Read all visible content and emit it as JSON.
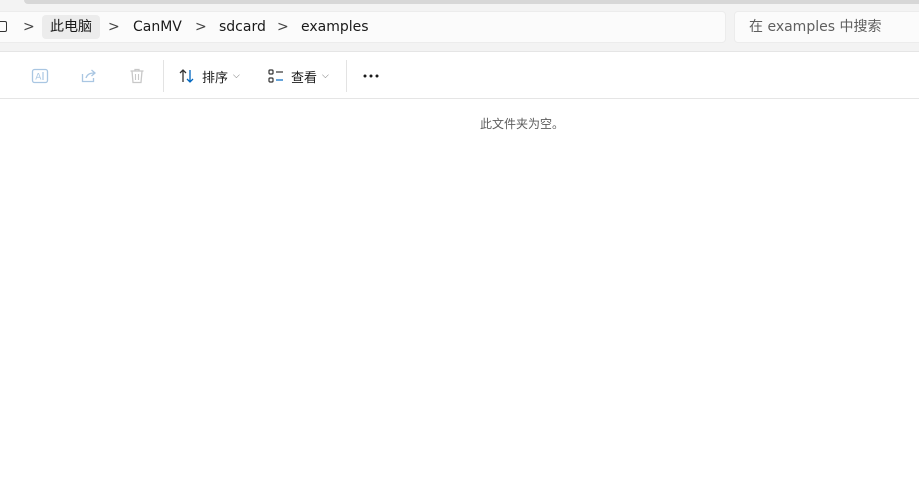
{
  "breadcrumb": {
    "items": [
      {
        "label": "此电脑"
      },
      {
        "label": "CanMV"
      },
      {
        "label": "sdcard"
      },
      {
        "label": "examples"
      }
    ],
    "separator": ">"
  },
  "search": {
    "placeholder": "在 examples 中搜索"
  },
  "toolbar": {
    "sort_label": "排序",
    "view_label": "查看",
    "more_label": "···"
  },
  "content": {
    "empty_message": "此文件夹为空。"
  },
  "colors": {
    "accent": "#0067c0",
    "disabled_icon": "#a9c6e2",
    "background": "#ffffff",
    "topbar": "#f3f3f3"
  }
}
